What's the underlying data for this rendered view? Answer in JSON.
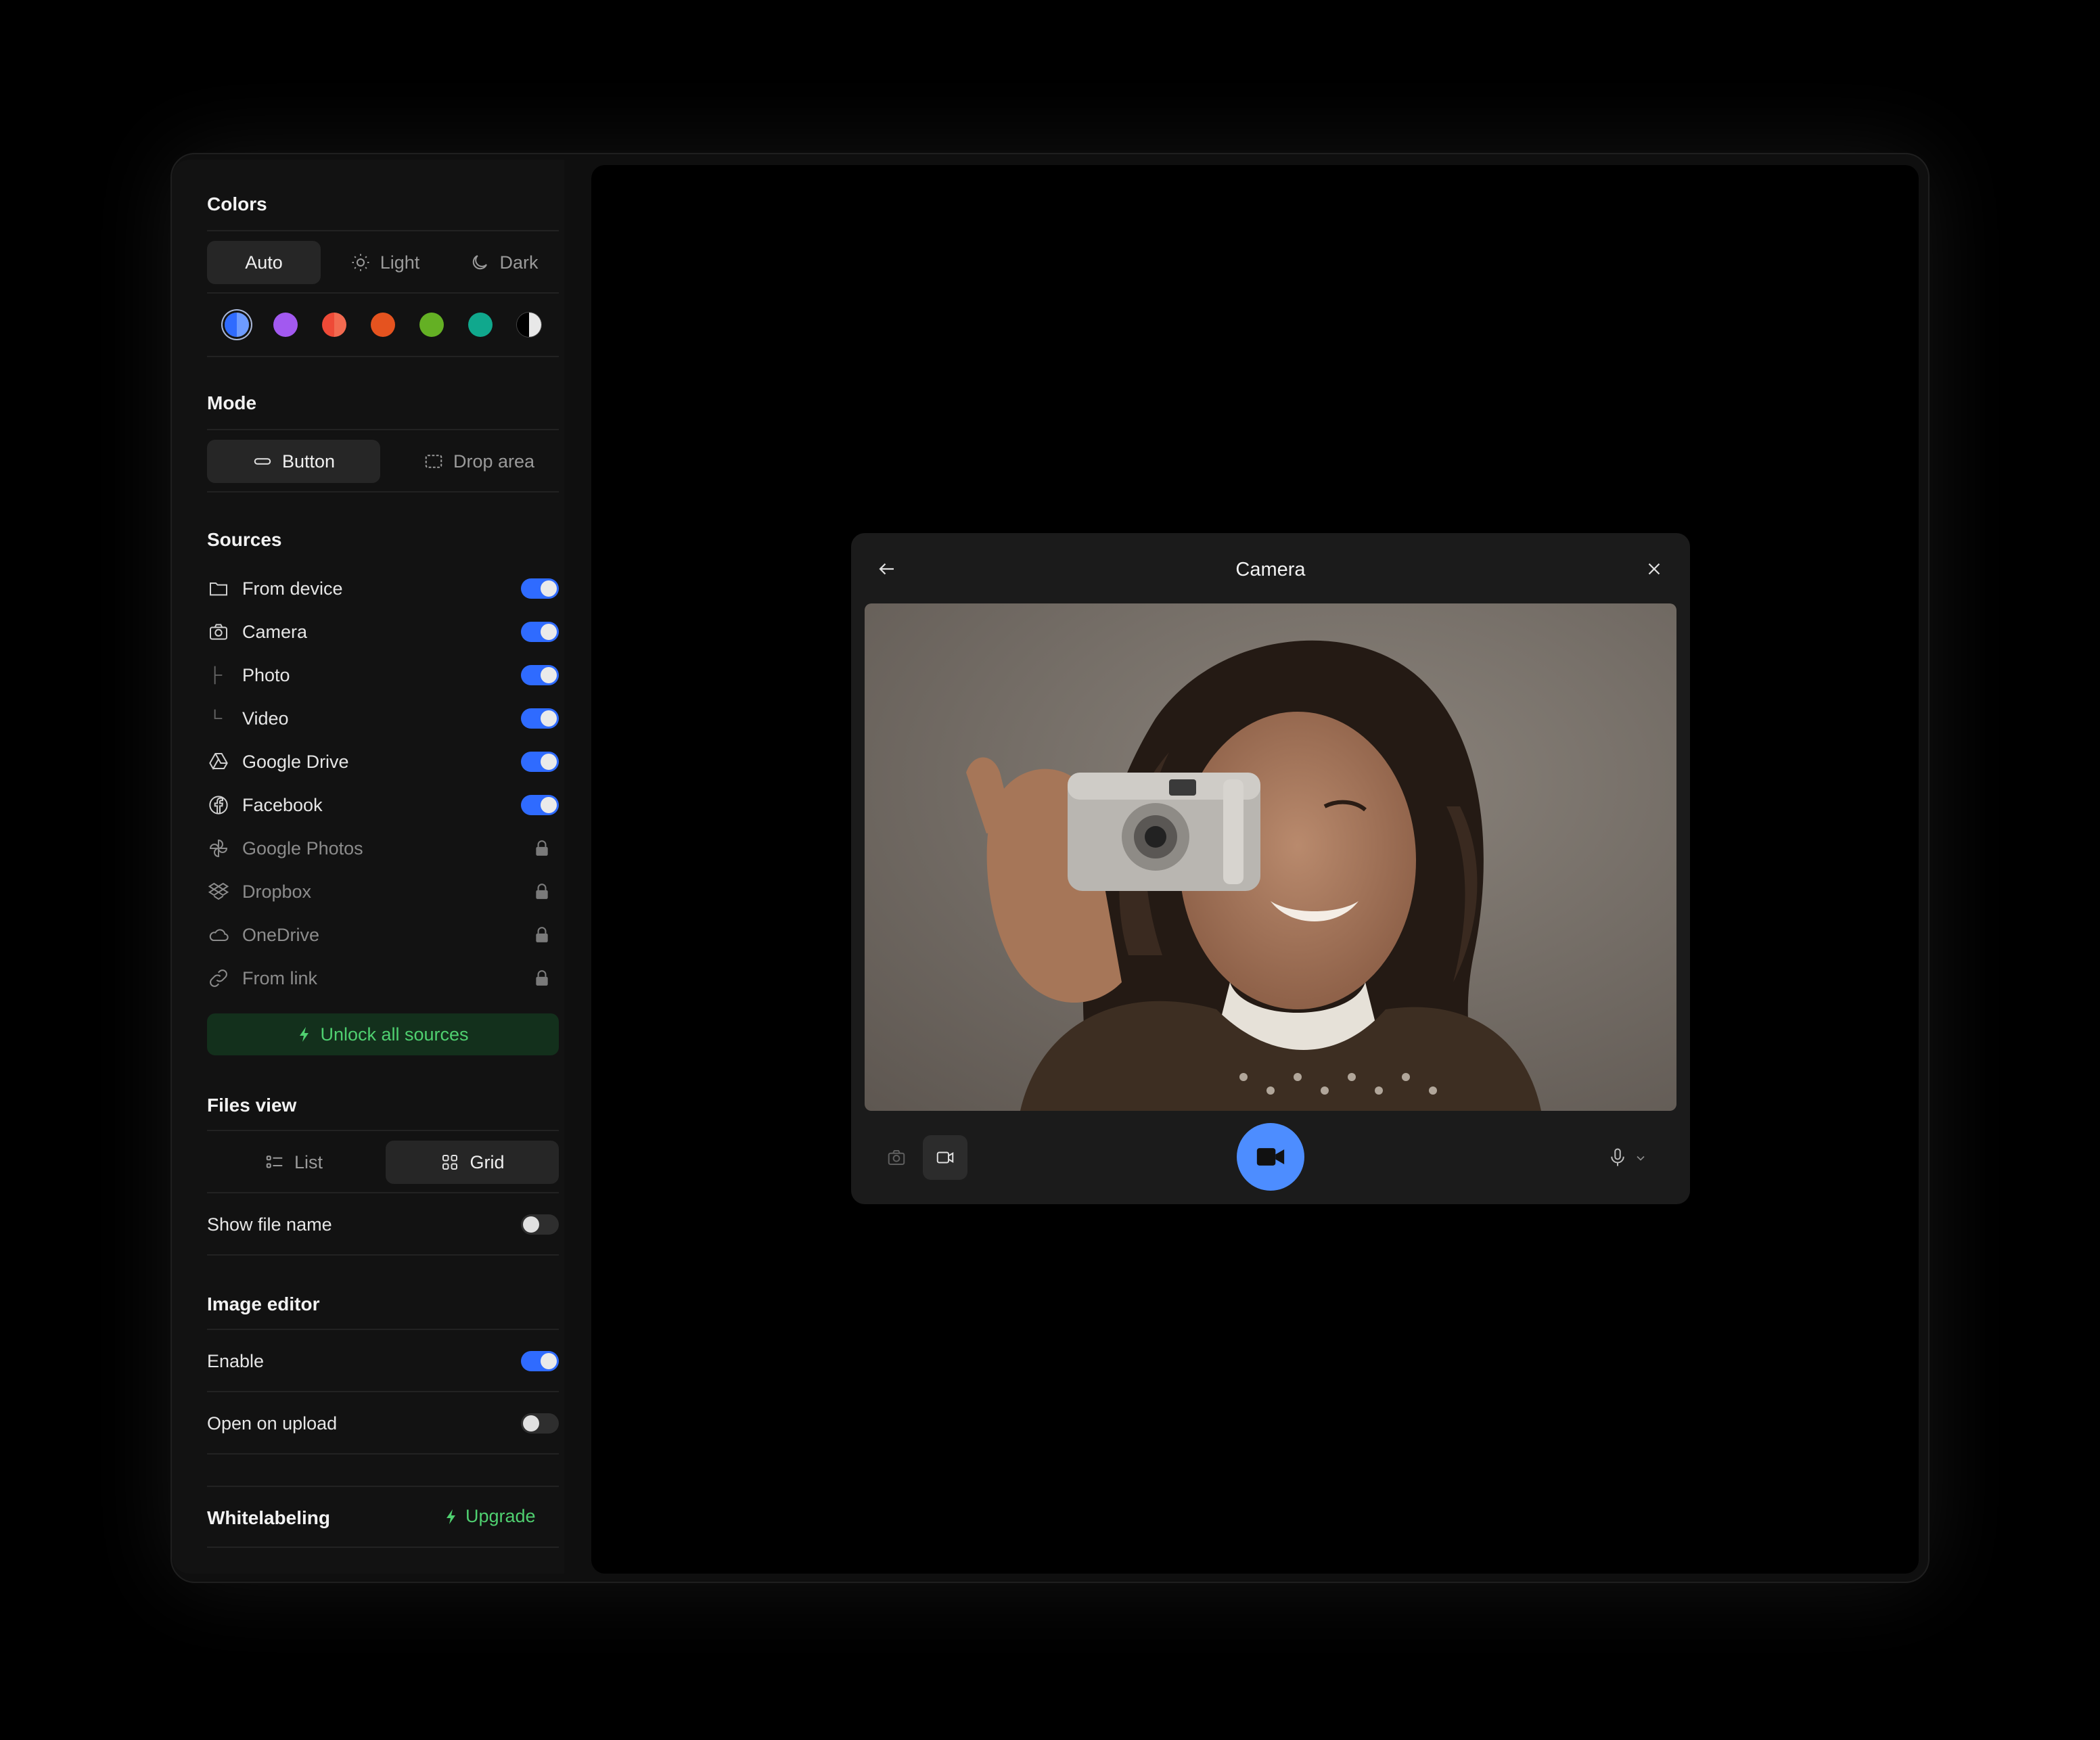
{
  "colors": {
    "title": "Colors",
    "themes": [
      {
        "label": "Auto",
        "icon": "none",
        "active": true
      },
      {
        "label": "Light",
        "icon": "sun-icon",
        "active": false
      },
      {
        "label": "Dark",
        "icon": "moon-icon",
        "active": false
      }
    ],
    "swatches": [
      "#4f7fff",
      "#a259f0",
      "#ee4a37",
      "#e5531f",
      "#64b024",
      "#10a88d",
      "#e8e8e8"
    ],
    "accent": "#2f6bff"
  },
  "mode": {
    "title": "Mode",
    "options": [
      {
        "label": "Button",
        "active": true
      },
      {
        "label": "Drop area",
        "active": false
      }
    ]
  },
  "sources": {
    "title": "Sources",
    "items": [
      {
        "label": "From device",
        "icon": "folder-icon",
        "enabled": true
      },
      {
        "label": "Camera",
        "icon": "camera-icon",
        "enabled": true
      },
      {
        "label": "Photo",
        "icon": "tree-branch-icon",
        "enabled": true
      },
      {
        "label": "Video",
        "icon": "tree-end-icon",
        "enabled": true
      },
      {
        "label": "Google Drive",
        "icon": "google-drive-icon",
        "enabled": true
      },
      {
        "label": "Facebook",
        "icon": "facebook-icon",
        "enabled": true
      },
      {
        "label": "Google Photos",
        "icon": "google-photos-icon",
        "locked": true
      },
      {
        "label": "Dropbox",
        "icon": "dropbox-icon",
        "locked": true
      },
      {
        "label": "OneDrive",
        "icon": "onedrive-icon",
        "locked": true
      },
      {
        "label": "From link",
        "icon": "link-icon",
        "locked": true
      }
    ],
    "unlock_label": "Unlock all sources"
  },
  "files_view": {
    "title": "Files view",
    "options": [
      {
        "label": "List",
        "active": false
      },
      {
        "label": "Grid",
        "active": true
      }
    ],
    "show_file_name": {
      "label": "Show file name",
      "enabled": false
    }
  },
  "image_editor": {
    "title": "Image editor",
    "enable": {
      "label": "Enable",
      "enabled": true
    },
    "open_on_upload": {
      "label": "Open on upload",
      "enabled": false
    }
  },
  "whitelabeling": {
    "title": "Whitelabeling",
    "upgrade_label": "Upgrade"
  },
  "camera_modal": {
    "title": "Camera",
    "mode": "video"
  }
}
